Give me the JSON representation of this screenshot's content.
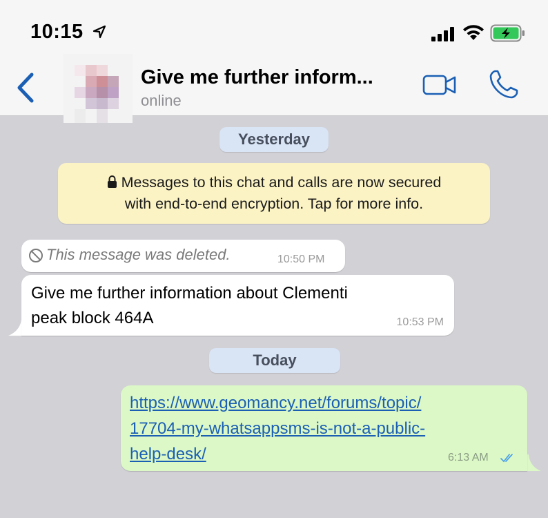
{
  "status_bar": {
    "time": "10:15"
  },
  "header": {
    "title": "Give me further inform...",
    "status": "online"
  },
  "dates": {
    "yesterday": "Yesterday",
    "today": "Today"
  },
  "system_message": {
    "line1": "Messages to this chat and calls are now secured",
    "line2": "with end-to-end encryption. Tap for more info."
  },
  "messages": [
    {
      "type": "deleted",
      "text": "This message was deleted.",
      "time": "10:50 PM"
    },
    {
      "type": "incoming",
      "line1": "Give me further information about Clementi",
      "line2": "peak block 464A",
      "time": "10:53 PM"
    },
    {
      "type": "outgoing",
      "link_line1": "https://www.geomancy.net/forums/topic/",
      "link_line2": "17704-my-whatsappsms-is-not-a-public-",
      "link_line3": "help-desk/",
      "time": "6:13 AM"
    }
  ],
  "colors": {
    "accent": "#1a5fb4",
    "outgoing_bubble": "#dcf8c6",
    "system_bubble": "#fcf3c5",
    "date_pill": "#d9e4f5",
    "chat_background": "#d1d1d6"
  },
  "icons": [
    "location-arrow-icon",
    "signal-icon",
    "wifi-icon",
    "battery-charging-icon",
    "back-chevron-icon",
    "video-call-icon",
    "phone-call-icon",
    "lock-icon",
    "deleted-ban-icon",
    "double-check-icon"
  ]
}
